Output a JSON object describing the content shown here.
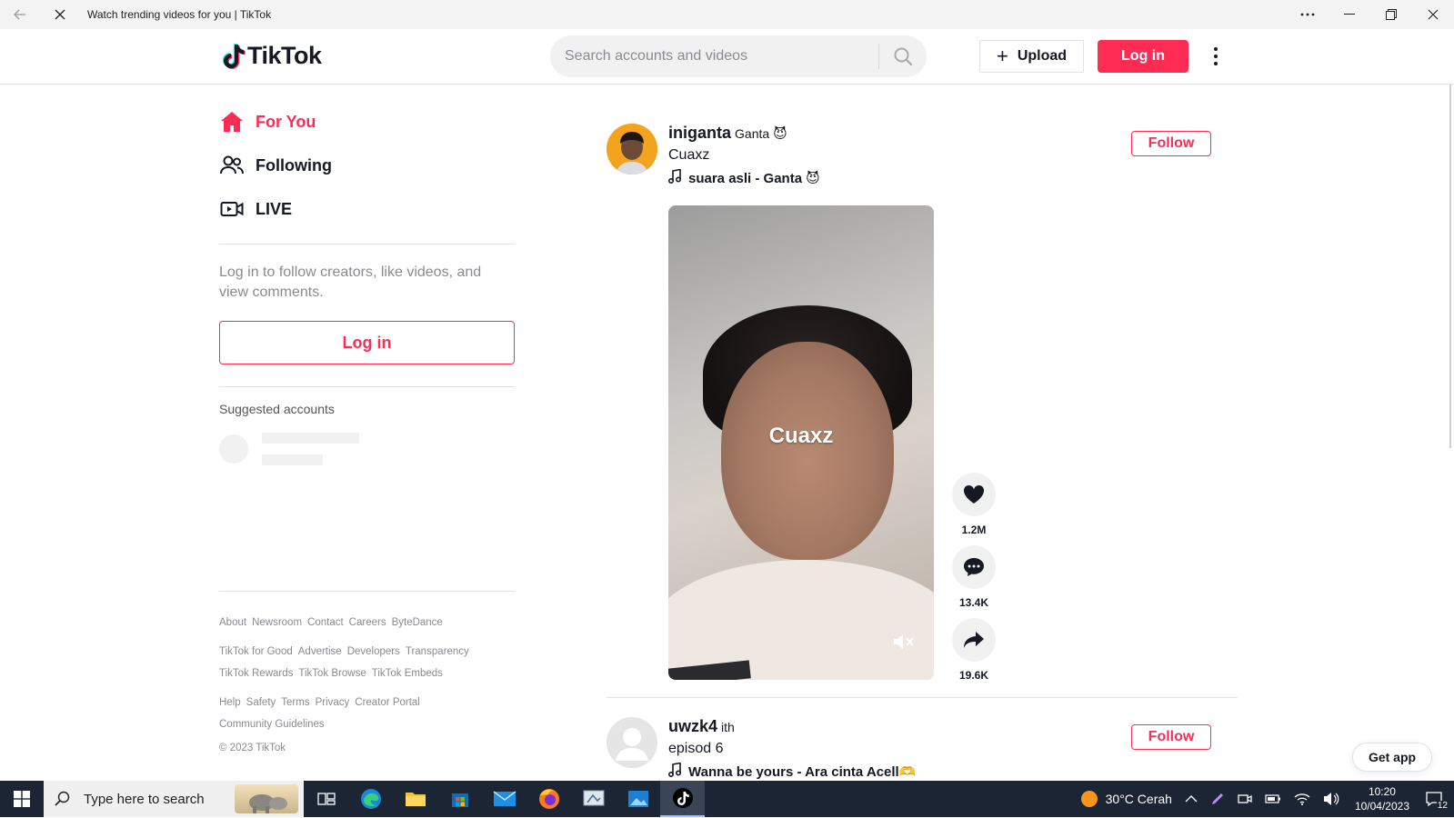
{
  "window": {
    "title": "Watch trending videos for you | TikTok"
  },
  "header": {
    "logo_text": "TikTok",
    "search_placeholder": "Search accounts and videos",
    "upload_label": "Upload",
    "login_label": "Log in"
  },
  "sidebar": {
    "nav": [
      {
        "label": "For You",
        "icon": "home-icon",
        "active": true
      },
      {
        "label": "Following",
        "icon": "people-icon",
        "active": false
      },
      {
        "label": "LIVE",
        "icon": "live-icon",
        "active": false
      }
    ],
    "login_prompt": "Log in to follow creators, like videos, and view comments.",
    "login_label": "Log in",
    "suggested_title": "Suggested accounts",
    "footer": {
      "row1": [
        "About",
        "Newsroom",
        "Contact",
        "Careers",
        "ByteDance"
      ],
      "row2": [
        "TikTok for Good",
        "Advertise",
        "Developers",
        "Transparency"
      ],
      "row3": [
        "TikTok Rewards",
        "TikTok Browse",
        "TikTok Embeds"
      ],
      "row4": [
        "Help",
        "Safety",
        "Terms",
        "Privacy",
        "Creator Portal"
      ],
      "row5": [
        "Community Guidelines"
      ],
      "copyright": "© 2023 TikTok"
    }
  },
  "feed": {
    "posts": [
      {
        "username": "iniganta",
        "nickname": "Ganta",
        "nickname_emoji": "😈",
        "caption": "Cuaxz",
        "music": "suara asli - Ganta",
        "music_emoji": "😈",
        "follow_label": "Follow",
        "video_caption": "Cuaxz",
        "likes": "1.2M",
        "comments": "13.4K",
        "shares": "19.6K"
      },
      {
        "username": "uwzk4",
        "nickname": "ith",
        "caption": "episod 6",
        "music": "Wanna be yours - Ara cinta Acell🫶",
        "follow_label": "Follow"
      }
    ],
    "get_app_label": "Get app"
  },
  "taskbar": {
    "search_placeholder": "Type here to search",
    "weather": "30°C  Cerah",
    "time": "10:20",
    "date": "10/04/2023",
    "notifications": "12"
  },
  "colors": {
    "brand": "#fe2c55",
    "text": "#161823",
    "muted": "#8a8b91"
  }
}
